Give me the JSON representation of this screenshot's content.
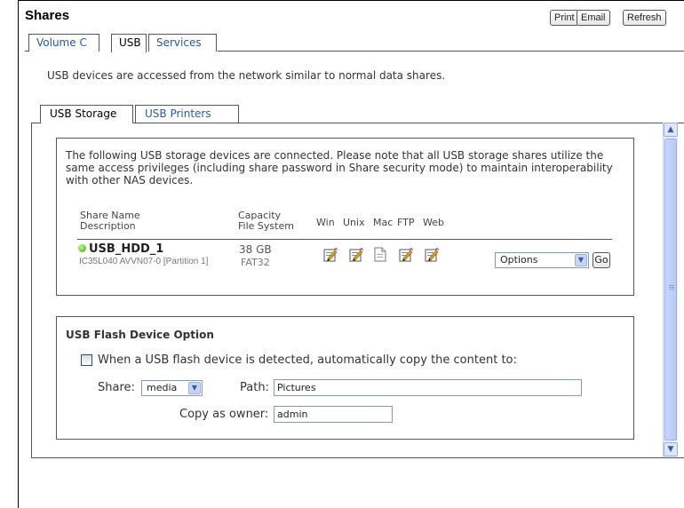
{
  "page": {
    "title": "Shares",
    "buttons": {
      "print": "Print",
      "email": "Email",
      "refresh": "Refresh"
    }
  },
  "top_tabs": [
    {
      "label": "Volume C",
      "active": false
    },
    {
      "label": "USB",
      "active": true
    },
    {
      "label": "Services",
      "active": false
    }
  ],
  "intro_text": "USB devices are accessed from the network similar to normal data shares.",
  "sub_tabs": [
    {
      "label": "USB Storage",
      "active": true
    },
    {
      "label": "USB Printers",
      "active": false
    }
  ],
  "storage": {
    "notice": "The following USB storage devices are connected. Please note that all USB storage shares utilize the same access privileges (including share password in Share security mode) to maintain interoperability with other NAS devices.",
    "headers": {
      "share_name": "Share Name",
      "description": "Description",
      "capacity": "Capacity",
      "file_system": "File System",
      "win": "Win",
      "unix": "Unix",
      "mac": "Mac",
      "ftp": "FTP",
      "web": "Web"
    },
    "row": {
      "name": "USB_HDD_1",
      "description": "IC35L040 AVVN07-0 [Partition 1]",
      "capacity": "38 GB",
      "file_system": "FAT32",
      "status_color": "#3aa312",
      "protocols": [
        {
          "name": "win",
          "icon": "edit-share-icon",
          "enabled": true
        },
        {
          "name": "unix",
          "icon": "edit-share-icon",
          "enabled": true
        },
        {
          "name": "mac",
          "icon": "document-icon",
          "enabled": false
        },
        {
          "name": "ftp",
          "icon": "edit-share-icon",
          "enabled": true
        },
        {
          "name": "web",
          "icon": "edit-share-icon",
          "enabled": true
        }
      ],
      "options_value": "Options",
      "go_label": "Go"
    }
  },
  "flash": {
    "title": "USB Flash Device Option",
    "checkbox_label": "When a USB flash device is detected, automatically copy the content to:",
    "checked": false,
    "share_label": "Share:",
    "share_value": "media",
    "path_label": "Path:",
    "path_value": "Pictures",
    "owner_label": "Copy as owner:",
    "owner_value": "admin"
  },
  "colors": {
    "link": "#2a58a5",
    "scrollbar": "#c8d6fa",
    "status_ok": "#3aa312"
  }
}
